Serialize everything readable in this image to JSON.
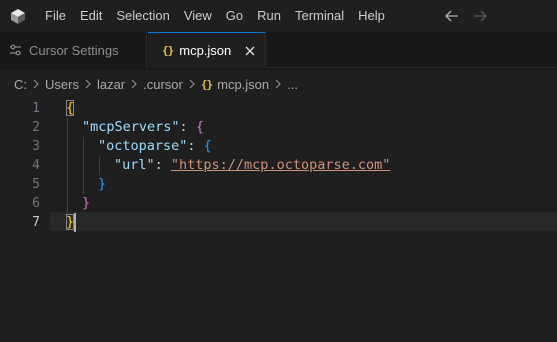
{
  "menu": {
    "items": [
      "File",
      "Edit",
      "Selection",
      "View",
      "Go",
      "Run",
      "Terminal",
      "Help"
    ]
  },
  "tabs": [
    {
      "label": "Cursor Settings",
      "icon": "settings-icon",
      "active": false
    },
    {
      "label": "mcp.json",
      "icon": "json-braces-icon",
      "active": true
    }
  ],
  "breadcrumb": {
    "segments": [
      "C:",
      "Users",
      "lazar",
      ".cursor",
      "mcp.json",
      "..."
    ]
  },
  "editor": {
    "json_icon_glyph": "{}",
    "current_line": 7,
    "line_numbers": [
      "1",
      "2",
      "3",
      "4",
      "5",
      "6",
      "7"
    ],
    "tokens": {
      "l1_open": "{",
      "l2_key": "\"mcpServers\"",
      "l2_colon": ": ",
      "l2_open": "{",
      "l3_key": "\"octoparse\"",
      "l3_colon": ": ",
      "l3_open": "{",
      "l4_key": "\"url\"",
      "l4_colon": ": ",
      "l4_value": "\"https://mcp.octoparse.com\"",
      "l5_close": "}",
      "l6_close": "}",
      "l7_close": "}"
    }
  },
  "colors": {
    "accent": "#0078d4",
    "brace_level1": "#ffd700",
    "brace_level2": "#da70d6",
    "brace_level3": "#179fff",
    "json_key": "#9cdcfe",
    "json_string": "#ce9178"
  }
}
